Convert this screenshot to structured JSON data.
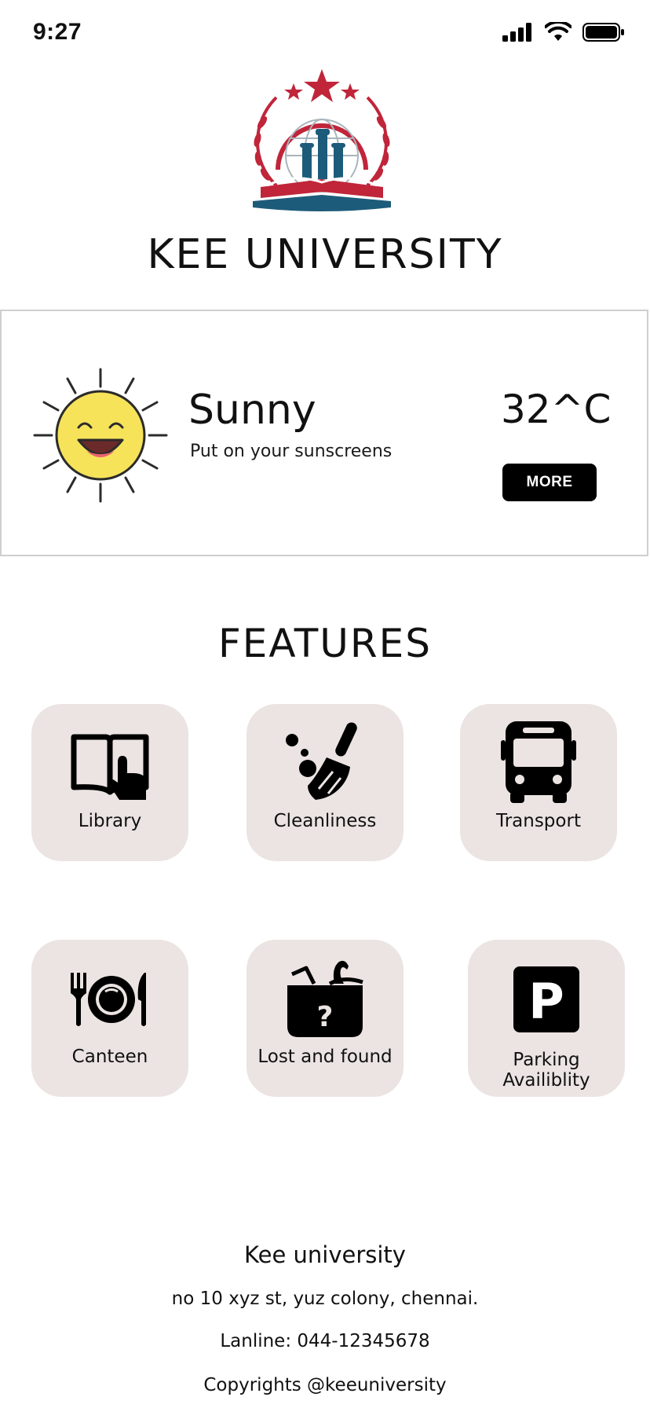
{
  "status_bar": {
    "time": "9:27",
    "icons": [
      "cellular-signal-icon",
      "wifi-icon",
      "battery-icon"
    ]
  },
  "header": {
    "logo": "university-emblem",
    "title": "KEE UNIVERSITY"
  },
  "weather": {
    "icon": "smiling-sun-icon",
    "condition": "Sunny",
    "message": "Put on your sunscreens",
    "temperature": "32^C",
    "more_label": "MORE"
  },
  "features": {
    "title": "FEATURES",
    "items": [
      {
        "label": "Library",
        "icon": "book-touch-icon"
      },
      {
        "label": "Cleanliness",
        "icon": "broom-icon"
      },
      {
        "label": "Transport",
        "icon": "bus-icon"
      },
      {
        "label": "Canteen",
        "icon": "plate-cutlery-icon"
      },
      {
        "label": "Lost and found",
        "icon": "lost-found-box-icon"
      },
      {
        "label": "Parking Availiblity",
        "label_lines": [
          "Parking",
          "Availiblity"
        ],
        "icon": "parking-icon"
      }
    ]
  },
  "footer": {
    "name": "Kee university",
    "address": "no 10 xyz st, yuz colony, chennai.",
    "landline": "Lanline: 044-12345678",
    "copyright": "Copyrights @keeuniversity"
  },
  "colors": {
    "tile_background": "#ebe4e2",
    "brand_red": "#c0253a",
    "brand_blue": "#1d5b7a",
    "sun_yellow": "#f7e35a",
    "button_black": "#000000"
  }
}
